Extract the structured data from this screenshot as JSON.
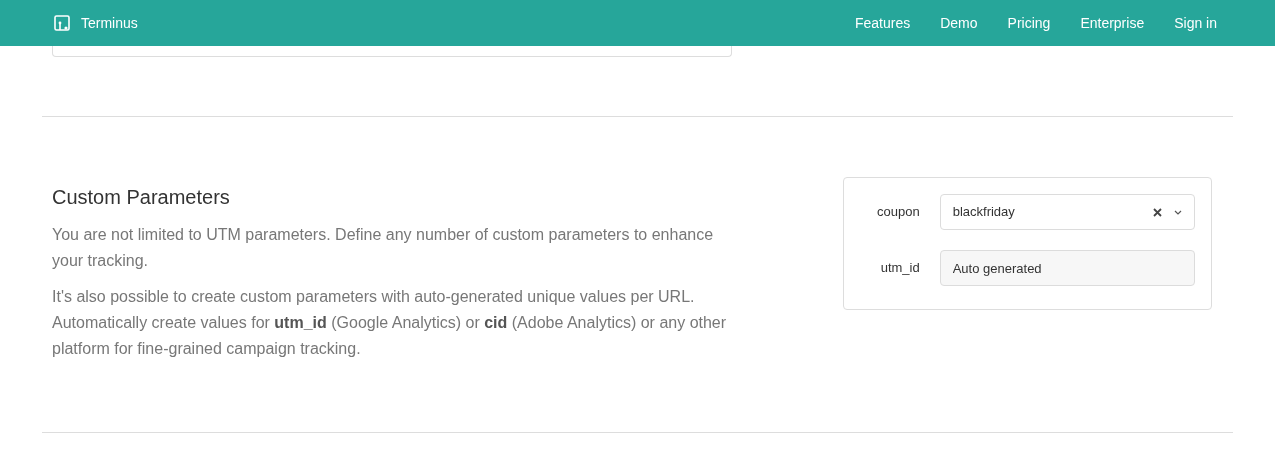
{
  "header": {
    "brand": "Terminus",
    "nav": [
      "Features",
      "Demo",
      "Pricing",
      "Enterprise",
      "Sign in"
    ]
  },
  "section": {
    "title": "Custom Parameters",
    "paragraphs": [
      "You are not limited to UTM parameters. Define any number of custom parameters to enhance your tracking.",
      "It's also possible to create custom parameters with auto-generated unique values per URL. Automatically create values for **utm_id** (Google Analytics) or **cid** (Adobe Analytics) or any other platform for fine-grained campaign tracking."
    ]
  },
  "form": {
    "fields": [
      {
        "label": "coupon",
        "kind": "select",
        "value": "blackfriday"
      },
      {
        "label": "utm_id",
        "kind": "text",
        "placeholder": "Auto generated",
        "disabled": true
      }
    ]
  }
}
